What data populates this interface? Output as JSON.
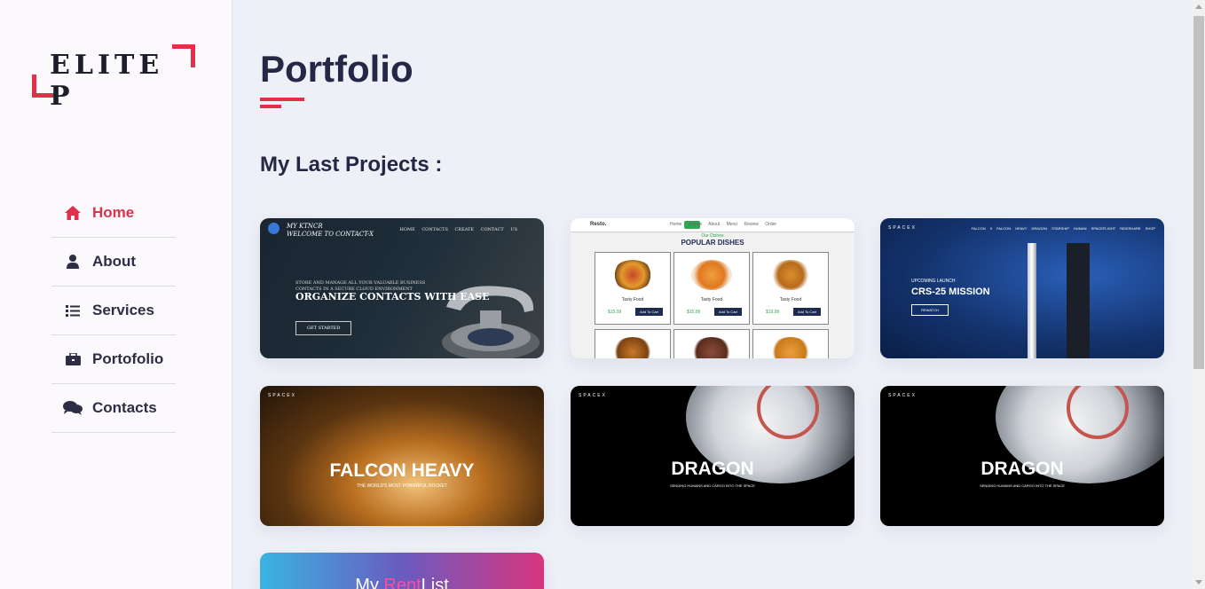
{
  "brand": {
    "logo_text": "ELITE P",
    "accent_color": "#e0304a"
  },
  "sidebar": {
    "items": [
      {
        "label": "Home",
        "icon": "home-icon",
        "active": true
      },
      {
        "label": "About",
        "icon": "user-icon",
        "active": false
      },
      {
        "label": "Services",
        "icon": "list-icon",
        "active": false
      },
      {
        "label": "Portofolio",
        "icon": "briefcase-icon",
        "active": false
      },
      {
        "label": "Contacts",
        "icon": "comments-icon",
        "active": false
      }
    ]
  },
  "main": {
    "title": "Portfolio",
    "subtitle": "My Last Projects :"
  },
  "projects": {
    "contact": {
      "header_line1": "MY KTNCR",
      "header_line2": "WELCOME TO CONTACT-X",
      "nav": "HOME CONTACTS CREATE CONTACT US",
      "tagline": "STORE AND MANAGE ALL YOUR VALUABLE BUSINESS CONTACTS IN A SECURE CLOUD ENVIRONMENT",
      "headline": "ORGANIZE CONTACTS WITH EASE",
      "button": "GET STARTED"
    },
    "resto": {
      "brand": "Resto.",
      "menu": "Home Dishes About Menu Review Order",
      "kicker": "Our Dishes",
      "title": "POPULAR DISHES",
      "dishes": [
        {
          "name": "Tasty Food",
          "price": "$15.99",
          "button": "Add To Cart"
        },
        {
          "name": "Tasty Food",
          "price": "$15.99",
          "button": "Add To Cart"
        },
        {
          "name": "Tasty Food",
          "price": "$19.99",
          "button": "Add To Cart"
        }
      ]
    },
    "crs": {
      "logo": "SPACEX",
      "menu": "FALCON 9 FALCON HEAVY DRAGON STARSHIP HUMAN SPACEFLIGHT RIDESHARE SHOP",
      "kicker": "UPCOMING LAUNCH",
      "title": "CRS-25 MISSION",
      "button": "REWATCH"
    },
    "falcon": {
      "logo": "SPACEX",
      "title": "FALCON HEAVY",
      "tagline": "THE WORLD'S MOST POWERFUL ROCKET"
    },
    "dragon1": {
      "logo": "SPACEX",
      "title": "DRAGON",
      "tagline": "SENDING HUMANS AND CARGO INTO THE SPACE"
    },
    "dragon2": {
      "logo": "SPACEX",
      "title": "DRAGON",
      "tagline": "SENDING HUMANS AND CARGO INTO THE SPACE"
    },
    "rentlist": {
      "title_pre": "My ",
      "title_accent": "Rent",
      "title_post": "List"
    }
  }
}
